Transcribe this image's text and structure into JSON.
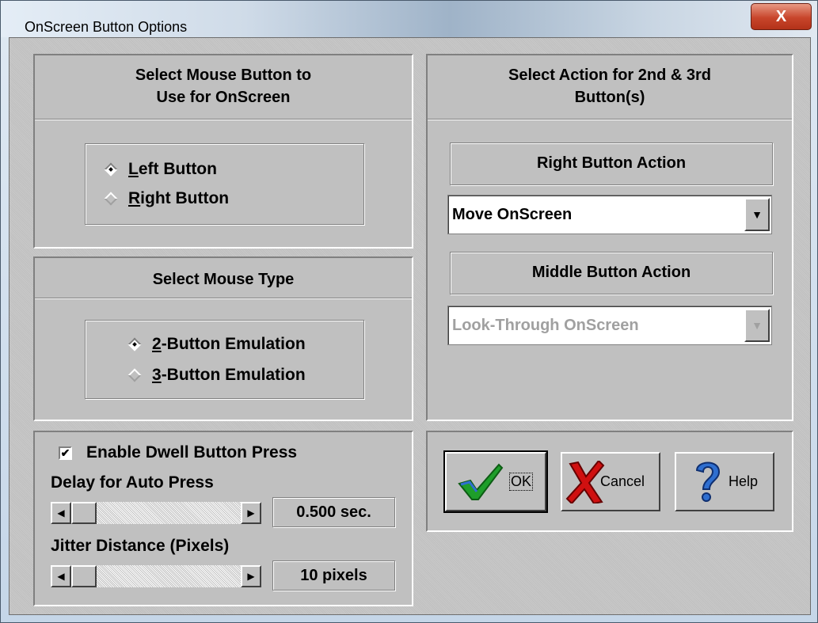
{
  "window": {
    "title": "OnScreen Button Options",
    "close_glyph": "X"
  },
  "mouse_button_group": {
    "title_line1": "Select Mouse Button to",
    "title_line2": "Use for OnScreen",
    "options": [
      {
        "key": "L",
        "rest": "eft Button",
        "selected": true
      },
      {
        "key": "R",
        "rest": "ight Button",
        "selected": false
      }
    ]
  },
  "mouse_type_group": {
    "title": "Select Mouse Type",
    "options": [
      {
        "key": "2",
        "rest": "-Button Emulation",
        "selected": true
      },
      {
        "key": "3",
        "rest": "-Button Emulation",
        "selected": false
      }
    ]
  },
  "action_group": {
    "title_line1": "Select Action for 2nd & 3rd",
    "title_line2": "Button(s)",
    "right_label": "Right Button Action",
    "right_value": "Move OnScreen",
    "middle_label": "Middle Button Action",
    "middle_value": "Look-Through OnScreen",
    "middle_enabled": false
  },
  "dwell": {
    "checkbox_label": "Enable Dwell Button Press",
    "checked": true,
    "delay_label": "Delay for Auto Press",
    "delay_value": "0.500 sec.",
    "jitter_label": "Jitter Distance (Pixels)",
    "jitter_value": "10 pixels",
    "left_arrow": "◀",
    "right_arrow": "▶"
  },
  "buttons": {
    "ok": "OK",
    "cancel": "Cancel",
    "help": "Help"
  },
  "icons": {
    "ok": "checkmark-icon",
    "cancel": "red-x-icon",
    "help": "question-mark-icon",
    "dropdown": "dropdown-arrow-icon"
  },
  "colors": {
    "face": "#c0c0c0",
    "close_button": "#c8452b",
    "check_green": "#1e9e2a",
    "cancel_red": "#d01010",
    "help_blue": "#2f6fd0",
    "disabled_text": "#a0a0a0"
  }
}
